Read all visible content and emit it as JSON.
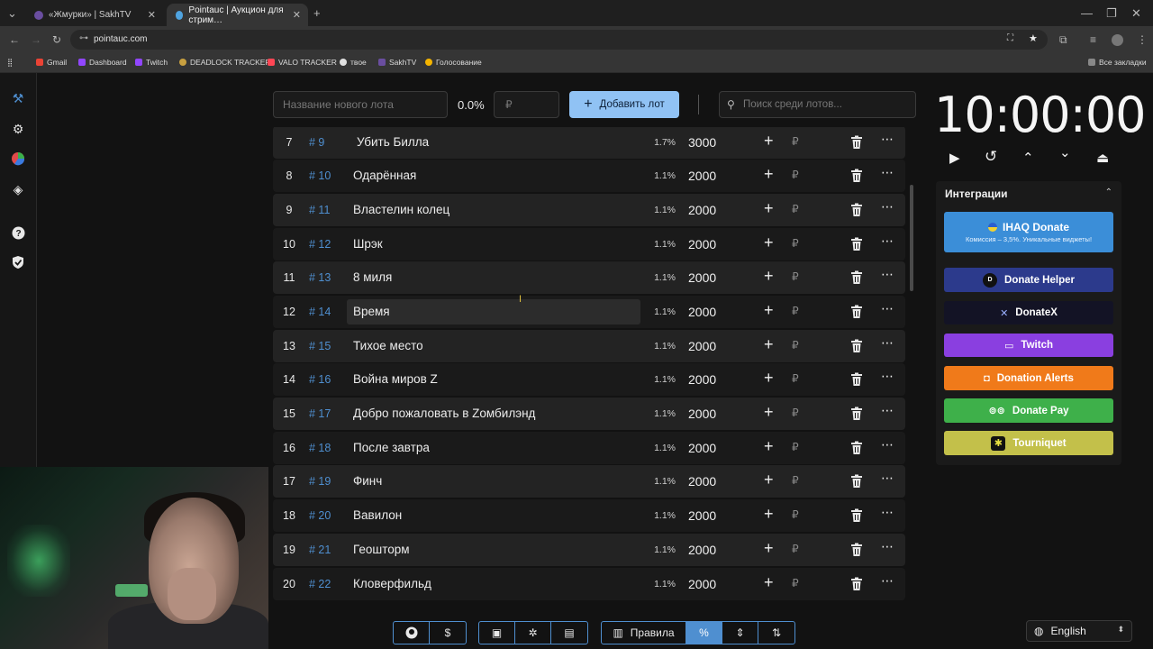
{
  "browser": {
    "tabs": [
      {
        "title": "«Жмурки» | SakhTV",
        "favicon_color": "#6a4ea0"
      },
      {
        "title": "Pointauc | Аукцион для стрим…",
        "favicon_color": "#4fa3e0"
      }
    ],
    "url": "pointauc.com",
    "bookmarks": [
      {
        "label": "Gmail",
        "color": "#ea4335"
      },
      {
        "label": "Dashboard",
        "color": "#9146ff"
      },
      {
        "label": "Twitch",
        "color": "#9146ff"
      },
      {
        "label": "DEADLOCK TRACKER",
        "color": "#c8a040"
      },
      {
        "label": "VALO TRACKER",
        "color": "#ff4655"
      },
      {
        "label": "твое",
        "color": "#e0e0e0"
      },
      {
        "label": "SakhTV",
        "color": "#6a4ea0"
      },
      {
        "label": "Голосование",
        "color": "#f4b400"
      }
    ],
    "all_bookmarks": "Все закладки"
  },
  "controls": {
    "new_lot_placeholder": "Название нового лота",
    "percent": "0.0%",
    "amount_placeholder": "₽",
    "add_lot": "Добавить лот",
    "search_placeholder": "Поиск среди лотов..."
  },
  "lots": [
    {
      "num": "7",
      "id": "# 9",
      "name": "Убить Билла",
      "percent": "1.7%",
      "amount": "3000"
    },
    {
      "num": "8",
      "id": "# 10",
      "name": "Одарённая",
      "percent": "1.1%",
      "amount": "2000"
    },
    {
      "num": "9",
      "id": "# 11",
      "name": "Властелин колец",
      "percent": "1.1%",
      "amount": "2000"
    },
    {
      "num": "10",
      "id": "# 12",
      "name": "Шрэк",
      "percent": "1.1%",
      "amount": "2000"
    },
    {
      "num": "11",
      "id": "# 13",
      "name": "8 миля",
      "percent": "1.1%",
      "amount": "2000"
    },
    {
      "num": "12",
      "id": "# 14",
      "name": "Время",
      "percent": "1.1%",
      "amount": "2000"
    },
    {
      "num": "13",
      "id": "# 15",
      "name": "Тихое место",
      "percent": "1.1%",
      "amount": "2000"
    },
    {
      "num": "14",
      "id": "# 16",
      "name": "Война миров Z",
      "percent": "1.1%",
      "amount": "2000"
    },
    {
      "num": "15",
      "id": "# 17",
      "name": "Добро пожаловать в Zомбилэнд",
      "percent": "1.1%",
      "amount": "2000"
    },
    {
      "num": "16",
      "id": "# 18",
      "name": "После завтра",
      "percent": "1.1%",
      "amount": "2000"
    },
    {
      "num": "17",
      "id": "# 19",
      "name": "Финч",
      "percent": "1.1%",
      "amount": "2000"
    },
    {
      "num": "18",
      "id": "# 20",
      "name": "Вавилон",
      "percent": "1.1%",
      "amount": "2000"
    },
    {
      "num": "19",
      "id": "# 21",
      "name": "Геошторм",
      "percent": "1.1%",
      "amount": "2000"
    },
    {
      "num": "20",
      "id": "# 22",
      "name": "Кловерфильд",
      "percent": "1.1%",
      "amount": "2000"
    }
  ],
  "currency": "₽",
  "timer": "10:00:00",
  "integrations": {
    "title": "Интеграции",
    "ihaq": {
      "label": "IHAQ Donate",
      "subtitle": "Комиссия – 3,5%. Уникальные виджеты!",
      "color": "#3b8ed8"
    },
    "items": [
      {
        "label": "Donate Helper",
        "color": "#2c3a8c"
      },
      {
        "label": "DonateX",
        "color": "#131325"
      },
      {
        "label": "Twitch",
        "color": "#8a3fe0"
      },
      {
        "label": "Donation Alerts",
        "color": "#f07a1a"
      },
      {
        "label": "Donate Pay",
        "color": "#3eb04a"
      },
      {
        "label": "Tourniquet",
        "color": "#c3c04a"
      }
    ]
  },
  "toolbar": {
    "rules": "Правила",
    "dollar": "$",
    "percent": "%"
  },
  "language": "English"
}
